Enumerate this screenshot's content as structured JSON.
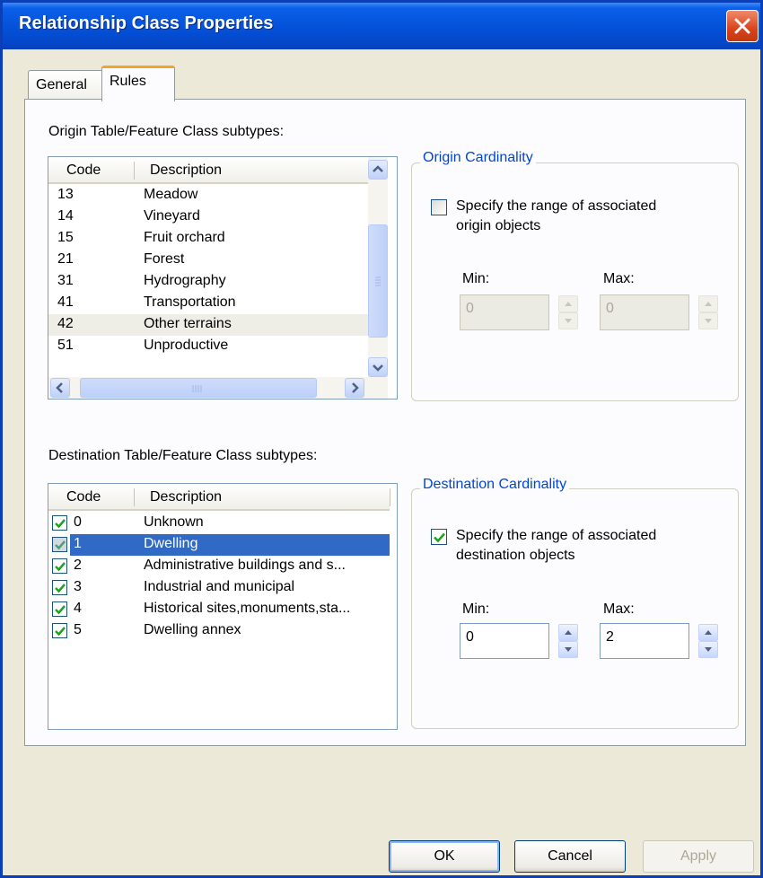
{
  "window": {
    "title": "Relationship Class Properties"
  },
  "tabs": [
    {
      "label": "General"
    },
    {
      "label": "Rules"
    }
  ],
  "origin": {
    "section_label": "Origin Table/Feature Class subtypes:",
    "columns": [
      "Code",
      "Description"
    ],
    "rows": [
      {
        "code": "13",
        "description": "Meadow"
      },
      {
        "code": "14",
        "description": "Vineyard"
      },
      {
        "code": "15",
        "description": "Fruit orchard"
      },
      {
        "code": "21",
        "description": "Forest"
      },
      {
        "code": "31",
        "description": "Hydrography"
      },
      {
        "code": "41",
        "description": "Transportation"
      },
      {
        "code": "42",
        "description": "Other terrains"
      },
      {
        "code": "51",
        "description": "Unproductive"
      }
    ],
    "cardinality": {
      "legend": "Origin Cardinality",
      "checkbox_label_line1": "Specify the range of associated",
      "checkbox_label_line2": "origin objects",
      "checked": false,
      "min_label": "Min:",
      "max_label": "Max:",
      "min_value": "0",
      "max_value": "0"
    }
  },
  "destination": {
    "section_label": "Destination Table/Feature Class subtypes:",
    "columns": [
      "Code",
      "Description"
    ],
    "rows": [
      {
        "code": "0",
        "description": "Unknown",
        "checked": true
      },
      {
        "code": "1",
        "description": "Dwelling",
        "checked": true,
        "selected": true
      },
      {
        "code": "2",
        "description": "Administrative buildings and s...",
        "checked": true
      },
      {
        "code": "3",
        "description": "Industrial and municipal",
        "checked": true
      },
      {
        "code": "4",
        "description": "Historical sites,monuments,sta...",
        "checked": true
      },
      {
        "code": "5",
        "description": "Dwelling annex",
        "checked": true
      }
    ],
    "cardinality": {
      "legend": "Destination Cardinality",
      "checkbox_label_line1": "Specify the range of associated",
      "checkbox_label_line2": "destination objects",
      "checked": true,
      "min_label": "Min:",
      "max_label": "Max:",
      "min_value": "0",
      "max_value": "2"
    }
  },
  "buttons": {
    "ok": "OK",
    "cancel": "Cancel",
    "apply": "Apply"
  },
  "colors": {
    "title_bar": "#0453da",
    "selection": "#316ac5",
    "legend_text": "#0046d5"
  }
}
